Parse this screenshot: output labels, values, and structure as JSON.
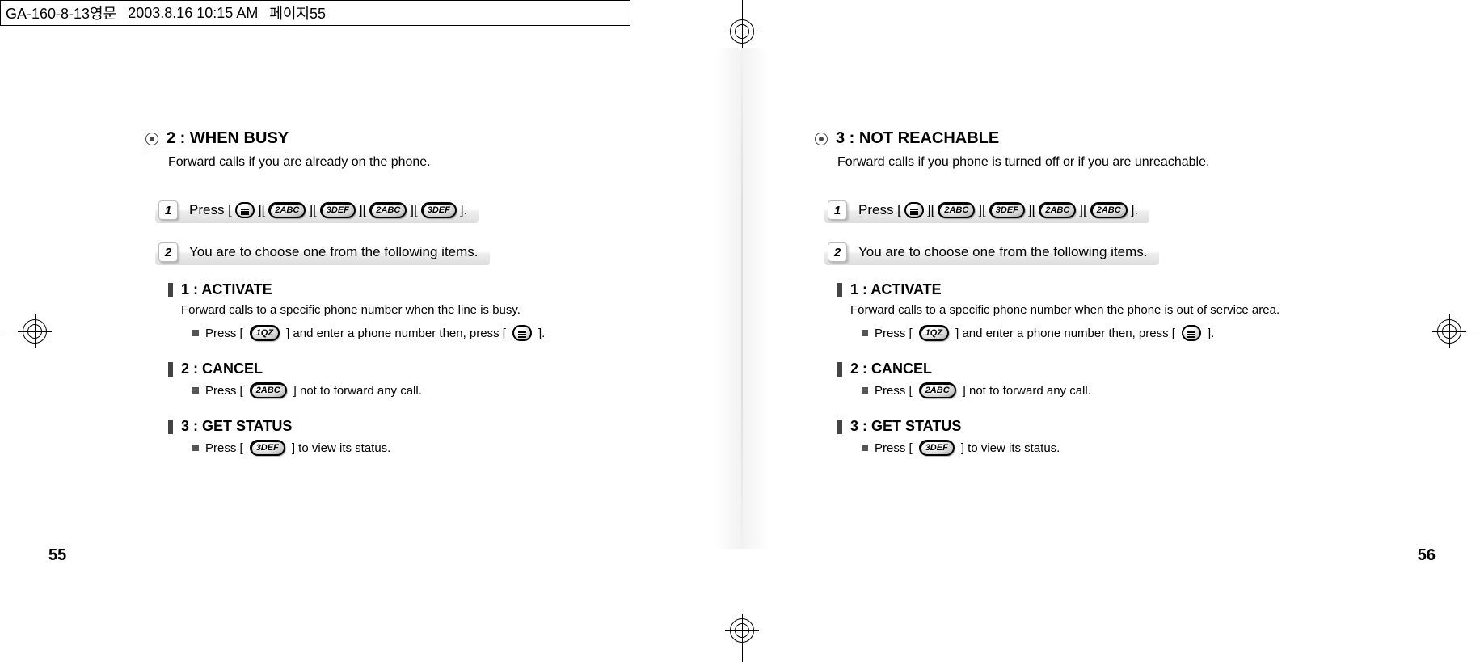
{
  "header": {
    "file": "GA-160-8-13영문",
    "timestamp": "2003.8.16 10:15 AM",
    "extra": "페이지55"
  },
  "pageNumbers": {
    "left": "55",
    "right": "56"
  },
  "left": {
    "sectionTitle": "2 : WHEN BUSY",
    "sectionSub": "Forward calls if you are already on the phone.",
    "step1_prefix": "Press [",
    "step1_tail": "].",
    "step1_keys": [
      "2ABC",
      "3DEF",
      "2ABC",
      "3DEF"
    ],
    "step2": "You are to choose one from the following items.",
    "sub1_title": "1 : ACTIVATE",
    "sub1_desc": "Forward calls to a specific phone number when the line is busy.",
    "sub1_bullet_a": "Press [",
    "sub1_key1": "1QZ",
    "sub1_bullet_b": "] and enter a phone number then, press [",
    "sub1_bullet_c": "].",
    "sub2_title": "2 : CANCEL",
    "sub2_bullet_a": "Press [",
    "sub2_key": "2ABC",
    "sub2_bullet_b": "] not to forward any call.",
    "sub3_title": "3 : GET STATUS",
    "sub3_bullet_a": "Press [",
    "sub3_key": "3DEF",
    "sub3_bullet_b": "] to view its status."
  },
  "right": {
    "sectionTitle": "3 : NOT REACHABLE",
    "sectionSub": "Forward calls if you phone is turned off or if you are unreachable.",
    "step1_prefix": "Press [",
    "step1_tail": "].",
    "step1_keys": [
      "2ABC",
      "3DEF",
      "2ABC",
      "2ABC"
    ],
    "step2": "You are to choose one from the following items.",
    "sub1_title": "1 : ACTIVATE",
    "sub1_desc": "Forward calls to a specific phone number when the phone is out of service area.",
    "sub1_bullet_a": "Press [",
    "sub1_key1": "1QZ",
    "sub1_bullet_b": "] and enter a phone number then, press [",
    "sub1_bullet_c": "].",
    "sub2_title": "2 : CANCEL",
    "sub2_bullet_a": "Press [",
    "sub2_key": "2ABC",
    "sub2_bullet_b": "] not to forward any call.",
    "sub3_title": "3 : GET STATUS",
    "sub3_bullet_a": "Press [",
    "sub3_key": "3DEF",
    "sub3_bullet_b": "] to view its status."
  }
}
